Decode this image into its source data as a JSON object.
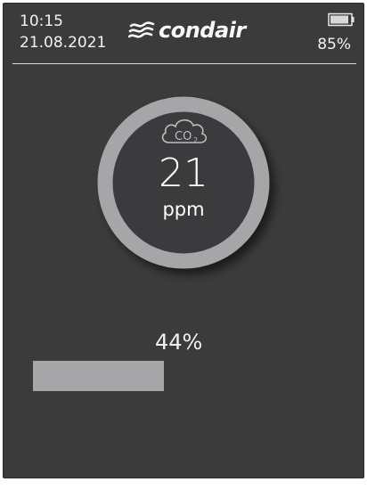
{
  "status": {
    "time": "10:15",
    "date": "21.08.2021",
    "logo": "condair",
    "battery_percent": "85%",
    "battery_icon": "battery-icon"
  },
  "reading": {
    "icon": "co2-cloud-icon",
    "icon_text": "CO",
    "icon_sub": "2",
    "value": "21",
    "unit": "ppm"
  },
  "level": {
    "label": "44%",
    "fraction": 0.44
  },
  "colors": {
    "background": "#3b3b3c",
    "ring": "#a6a6a8",
    "bar": "#a6a6a8",
    "text": "#f2f2f2"
  }
}
